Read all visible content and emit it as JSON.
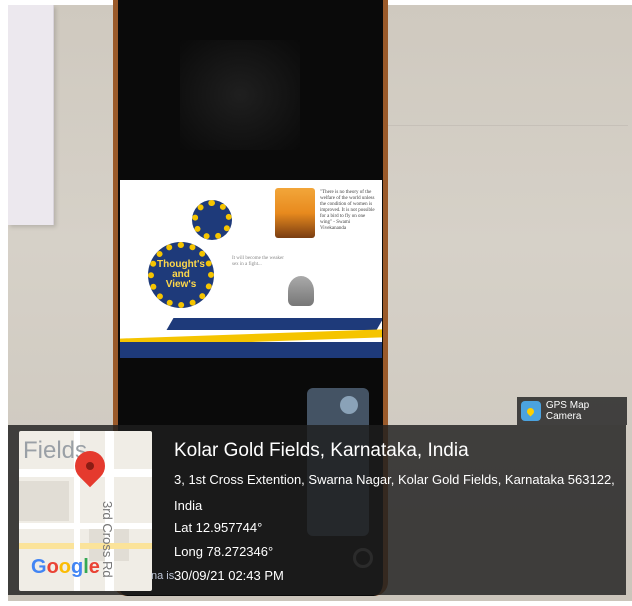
{
  "location": {
    "title": "Kolar Gold Fields, Karnataka, India",
    "address_line1": "3, 1st Cross Extention, Swarna Nagar, Kolar Gold Fields, Karnataka 563122,",
    "address_line2": "India",
    "lat": "Lat 12.957744°",
    "long": "Long 78.272346°",
    "timestamp": "30/09/21 02:43 PM"
  },
  "badge": {
    "label": "GPS Map Camera",
    "icon": "gps-map-camera-icon"
  },
  "map": {
    "area_label": "Fields",
    "road_label": "3rd Cross Rd",
    "logo": [
      "G",
      "o",
      "o",
      "g",
      "l",
      "e"
    ],
    "pin_icon": "location-pin-icon"
  },
  "card": {
    "gear_text": [
      "Thought's",
      "and",
      "View's"
    ],
    "quote1": "\"There is no theory of the welfare of the world unless the condition of women is improved. It is not possible for a bird to fly on one wing\" - Swami Vivekananda",
    "quote2": "It will become the weaker sex in a fight..."
  },
  "ghost_text": "na is"
}
